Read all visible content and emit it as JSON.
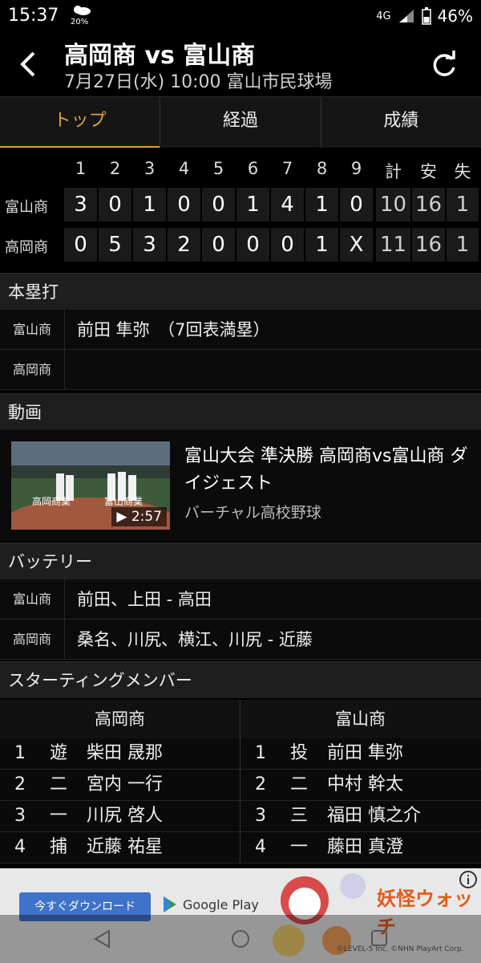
{
  "status": {
    "time": "15:37",
    "weather_pct": "20%",
    "network": "4G",
    "battery": "46%"
  },
  "header": {
    "title": "高岡商 vs 富山商",
    "subtitle": "7月27日(水) 10:00 富山市民球場"
  },
  "tabs": [
    {
      "label": "トップ"
    },
    {
      "label": "経過"
    },
    {
      "label": "成績"
    }
  ],
  "scoreboard": {
    "headers": [
      "1",
      "2",
      "3",
      "4",
      "5",
      "6",
      "7",
      "8",
      "9",
      "計",
      "安",
      "失"
    ],
    "teams": [
      {
        "name": "富山商",
        "innings": [
          "3",
          "0",
          "1",
          "0",
          "0",
          "1",
          "4",
          "1",
          "0"
        ],
        "total": "10",
        "hits": "16",
        "errors": "1"
      },
      {
        "name": "高岡商",
        "innings": [
          "0",
          "5",
          "3",
          "2",
          "0",
          "0",
          "0",
          "1",
          "X"
        ],
        "total": "11",
        "hits": "16",
        "errors": "1"
      }
    ]
  },
  "homerun": {
    "title": "本塁打",
    "rows": [
      {
        "team": "富山商",
        "value": "前田 隼弥　（7回表満塁）"
      },
      {
        "team": "高岡商",
        "value": ""
      }
    ]
  },
  "video": {
    "section": "動画",
    "title": "富山大会 準決勝 高岡商vs富山商 ダイジェスト",
    "source": "バーチャル高校野球",
    "duration": "2:57",
    "thumb_left": "高岡商業",
    "thumb_right": "富山商業"
  },
  "battery_section": {
    "title": "バッテリー",
    "rows": [
      {
        "team": "富山商",
        "value": "前田、上田 - 高田"
      },
      {
        "team": "高岡商",
        "value": "桑名、川尻、横江、川尻 - 近藤"
      }
    ]
  },
  "lineup": {
    "title": "スターティングメンバー",
    "left_team": "高岡商",
    "right_team": "富山商",
    "rows": [
      {
        "l_no": "1",
        "l_pos": "遊",
        "l_name": "柴田 晟那",
        "r_no": "1",
        "r_pos": "投",
        "r_name": "前田 隼弥"
      },
      {
        "l_no": "2",
        "l_pos": "二",
        "l_name": "宮内 一行",
        "r_no": "2",
        "r_pos": "二",
        "r_name": "中村 幹太"
      },
      {
        "l_no": "3",
        "l_pos": "一",
        "l_name": "川尻 啓人",
        "r_no": "3",
        "r_pos": "三",
        "r_name": "福田 慎之介"
      },
      {
        "l_no": "4",
        "l_pos": "捕",
        "l_name": "近藤 祐星",
        "r_no": "4",
        "r_pos": "一",
        "r_name": "藤田 真澄"
      }
    ]
  },
  "ad": {
    "button": "今すぐダウンロード",
    "store": "Google Play",
    "brand": "妖怪ウォッチ",
    "copyright": "©LEVEL-5 Inc. ©NHN PlayArt Corp."
  },
  "colors": {
    "accent": "#e0a040",
    "background": "#000000",
    "cell": "#1a1a1a"
  }
}
